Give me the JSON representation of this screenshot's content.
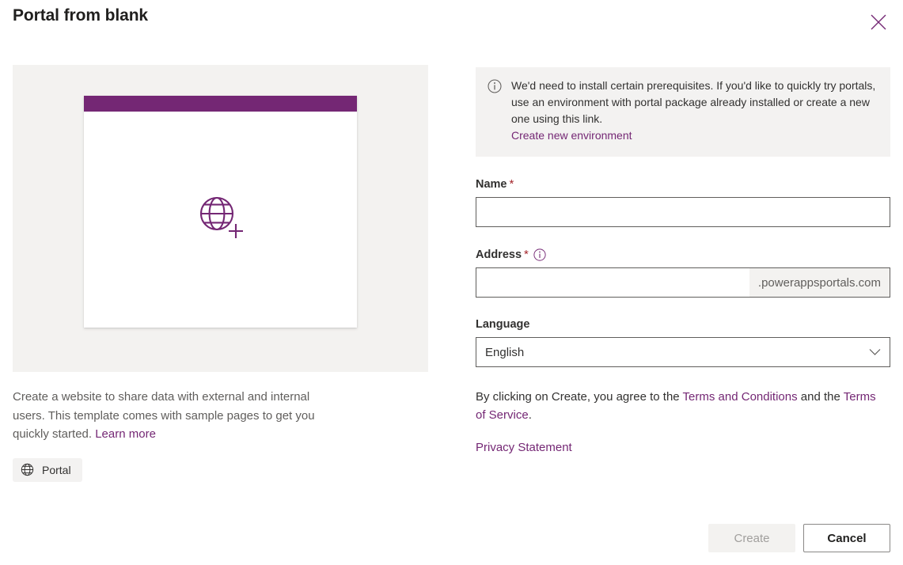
{
  "dialog": {
    "title": "Portal from blank",
    "close_icon": "close-icon"
  },
  "left_pane": {
    "preview": {
      "icon": "globe-plus-icon",
      "header_color": "#742774",
      "card_background": "#ffffff",
      "surface_background": "#f3f2f0"
    },
    "description": {
      "text_before_link": "Create a website to share data with external and internal users. This template comes with sample pages to get you quickly started. ",
      "link_label": "Learn more"
    },
    "tags": [
      {
        "label": "Portal",
        "icon": "globe-icon"
      }
    ]
  },
  "right_pane": {
    "banner": {
      "icon": "info-circle-icon",
      "message": "We'd need to install certain prerequisites. If you'd like to quickly try portals, use an environment with portal package already installed or create a new one using this link.",
      "link_label": "Create new environment",
      "background": "#f3f2f1"
    },
    "fields": {
      "name": {
        "label": "Name",
        "required_marker": "*",
        "value": "",
        "placeholder": ""
      },
      "address": {
        "label": "Address",
        "required_marker": "*",
        "info_icon": "info-circle-icon",
        "value": "",
        "placeholder": "",
        "suffix": ".powerappsportals.com"
      },
      "language": {
        "label": "Language",
        "selected": "English",
        "chevron_icon": "chevron-down-icon"
      }
    },
    "terms": {
      "prefix": "By clicking on Create, you agree to the ",
      "terms_and_conditions_label": "Terms and Conditions",
      "middle": " and the ",
      "terms_of_service_label": "Terms of Service",
      "suffix": ".",
      "privacy_label": "Privacy Statement"
    }
  },
  "footer": {
    "create_label": "Create",
    "cancel_label": "Cancel"
  },
  "colors": {
    "accent_purple": "#742774",
    "link_purple": "#742774",
    "required_red": "#a4262c",
    "neutral_light": "#f3f2f1",
    "neutral_border": "#605e5c",
    "text_primary": "#323130",
    "text_secondary": "#605e5c",
    "disabled_text": "#a19f9d"
  }
}
